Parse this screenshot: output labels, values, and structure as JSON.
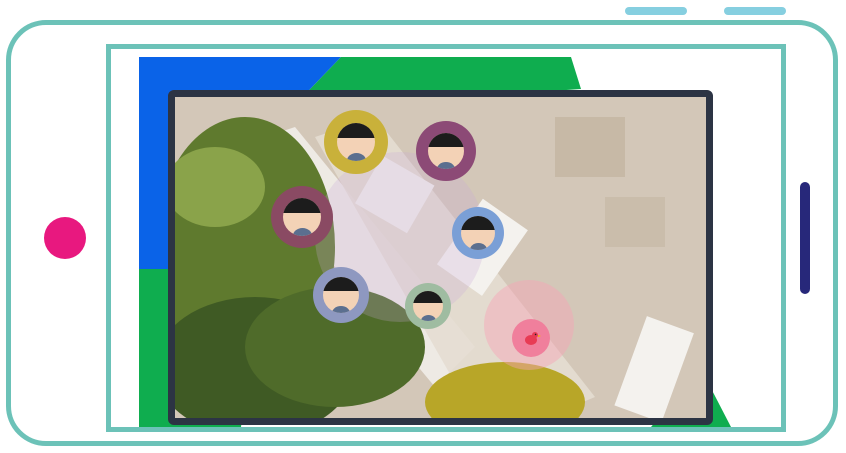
{
  "colors": {
    "phone_outline": "#6cc2b8",
    "home_button": "#e8187f",
    "side_bar": "#27287a",
    "top_buttons": "#86cfe0",
    "bg_blue": "#0a63e8",
    "bg_green": "#0fad4f",
    "tablet_bezel": "#2c3444",
    "ground": "#d3c7b8",
    "vegetation": "#5f7a2e"
  },
  "icons": {
    "user_avatar": "person-avatar-icon",
    "pet_marker": "bird-icon"
  },
  "avatars": [
    {
      "ring_color": "#c9b13a"
    },
    {
      "ring_color": "#8c4a76"
    },
    {
      "ring_color": "#8a4a63"
    },
    {
      "ring_color": "#7a9fd6"
    },
    {
      "ring_color": "#8e98c0"
    },
    {
      "ring_color": "#9fbca1"
    }
  ],
  "pet_marker": {
    "ring_color": "#f07f9c"
  }
}
